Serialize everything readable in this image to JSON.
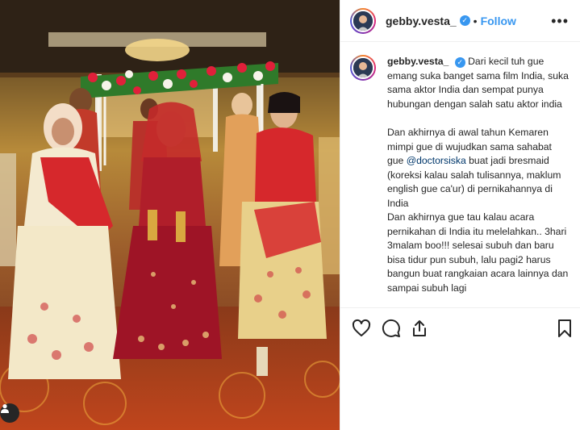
{
  "post": {
    "username": "gebby.vesta_",
    "verified": true,
    "follow_label": "Follow",
    "separator": "•",
    "more_label": "•••",
    "caption": {
      "author": "gebby.vesta_",
      "para1": "Dari kecil tuh gue emang suka banget sama film India, suka sama aktor India dan sempat punya hubungan dengan salah satu aktor india",
      "para2_before": "Dan akhirnya di awal tahun Kemaren mimpi gue di wujudkan sama sahabat gue ",
      "mention": "@doctorsiska",
      "para2_after": " buat jadi bresmaid (koreksi kalau salah tulisannya, maklum english gue ca'ur) di pernikahannya di India",
      "para3": "Dan akhirnya gue tau kalau acara pernikahan di India itu melelahkan.. 3hari 3malam boo!!! selesai subuh dan baru bisa tidur pun subuh, lalu pagi2 harus bangun buat rangkaian acara lainnya dan sampai subuh lagi"
    },
    "icons": {
      "like": "heart-icon",
      "comment": "comment-icon",
      "share": "share-icon",
      "save": "bookmark-icon",
      "tagged": "user-tag-icon",
      "verified": "verified-badge-icon"
    },
    "colors": {
      "link": "#3897f0",
      "mention": "#00376b",
      "text": "#262626",
      "divider": "#efefef"
    }
  }
}
